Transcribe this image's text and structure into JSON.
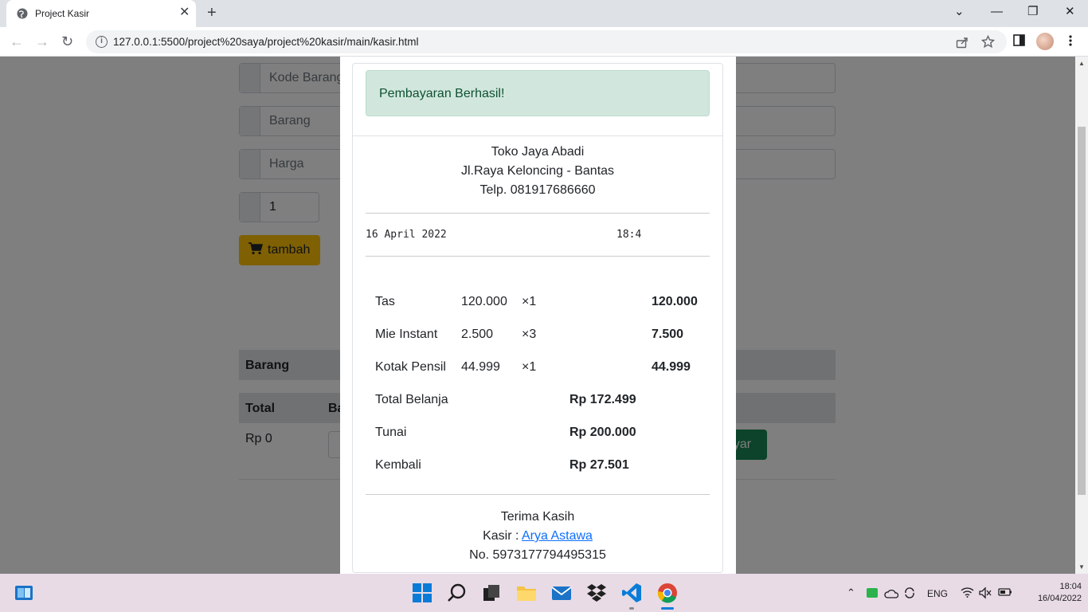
{
  "browser": {
    "tab_title": "Project Kasir",
    "tab_close": "✕",
    "new_tab": "+",
    "url": "127.0.0.1:5500/project%20saya/project%20kasir/main/kasir.html",
    "window_controls": {
      "dropdown": "⌄",
      "minimize": "—",
      "restore": "❐",
      "close": "✕"
    },
    "nav": {
      "back": "←",
      "forward": "→",
      "reload": "↻"
    }
  },
  "form": {
    "kode_barang_placeholder": "Kode Barang",
    "barang_placeholder": "Barang",
    "harga_placeholder": "Harga",
    "qty_value": "1",
    "tambah_label": "tambah"
  },
  "table": {
    "header_barang": "Barang",
    "header_total": "Total",
    "header_bayar_partial": "Ba",
    "total_value": "Rp 0",
    "bayar_button_partial": "ayar"
  },
  "receipt": {
    "alert": "Pembayaran Berhasil!",
    "store_name": "Toko Jaya Abadi",
    "address": "Jl.Raya Keloncing - Bantas",
    "phone": "Telp. 081917686660",
    "date": "16 April 2022",
    "time": "18:4",
    "items": [
      {
        "name": "Tas",
        "price": "120.000",
        "qty": "×1",
        "subtotal": "120.000"
      },
      {
        "name": "Mie Instant",
        "price": "2.500",
        "qty": "×3",
        "subtotal": "7.500"
      },
      {
        "name": "Kotak Pensil",
        "price": "44.999",
        "qty": "×1",
        "subtotal": "44.999"
      }
    ],
    "summary": [
      {
        "label": "Total Belanja",
        "value": "Rp 172.499"
      },
      {
        "label": "Tunai",
        "value": "Rp 200.000"
      },
      {
        "label": "Kembali",
        "value": "Rp 27.501"
      }
    ],
    "thanks": "Terima Kasih",
    "kasir_label": "Kasir : ",
    "kasir_name": "Arya Astawa",
    "number": "No. 5973177794495315"
  },
  "taskbar": {
    "language": "ENG",
    "time": "18:04",
    "date": "16/04/2022"
  },
  "colors": {
    "success_alert_bg": "#d1e7dd",
    "warning_button": "#ffc107",
    "success_button": "#198754",
    "link": "#0d6efd"
  }
}
